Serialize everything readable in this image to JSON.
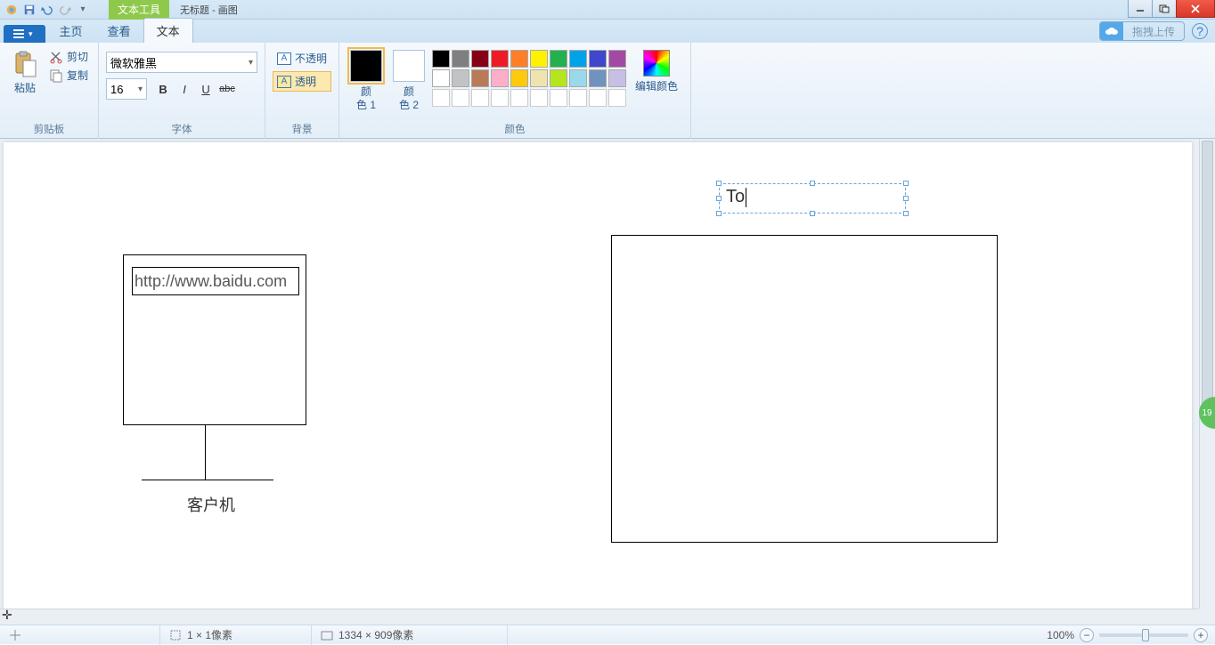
{
  "title_context_tab": "文本工具",
  "title_doc": "无标题 - 画图",
  "tabs": {
    "file": "",
    "home": "主页",
    "view": "查看",
    "text": "文本"
  },
  "drag_upload": "拖拽上传",
  "ribbon": {
    "clipboard": {
      "paste": "粘贴",
      "cut": "剪切",
      "copy": "复制",
      "group": "剪贴板"
    },
    "font": {
      "family": "微软雅黑",
      "size": "16",
      "group": "字体"
    },
    "background": {
      "opaque": "不透明",
      "transparent": "透明",
      "group": "背景"
    },
    "colors": {
      "color1_label_a": "颜",
      "color1_label_b": "色 1",
      "color2_label_a": "颜",
      "color2_label_b": "色 2",
      "edit": "编辑颜色",
      "group": "颜色",
      "color1": "#000000",
      "color2": "#ffffff",
      "row1": [
        "#000000",
        "#7f7f7f",
        "#880015",
        "#ed1c24",
        "#ff7f27",
        "#fff200",
        "#22b14c",
        "#00a2e8",
        "#3f48cc",
        "#a349a4"
      ],
      "row2": [
        "#ffffff",
        "#c3c3c3",
        "#b97a57",
        "#ffaec9",
        "#ffc90e",
        "#efe4b0",
        "#b5e61d",
        "#99d9ea",
        "#7092be",
        "#c8bfe7"
      ]
    }
  },
  "canvas": {
    "url_text": "http://www.baidu.com",
    "client_label": "客户机",
    "editing_text": "To"
  },
  "status": {
    "cursor_size": "1 × 1像素",
    "canvas_size": "1334 × 909像素",
    "zoom": "100%"
  },
  "badge_right": "19"
}
